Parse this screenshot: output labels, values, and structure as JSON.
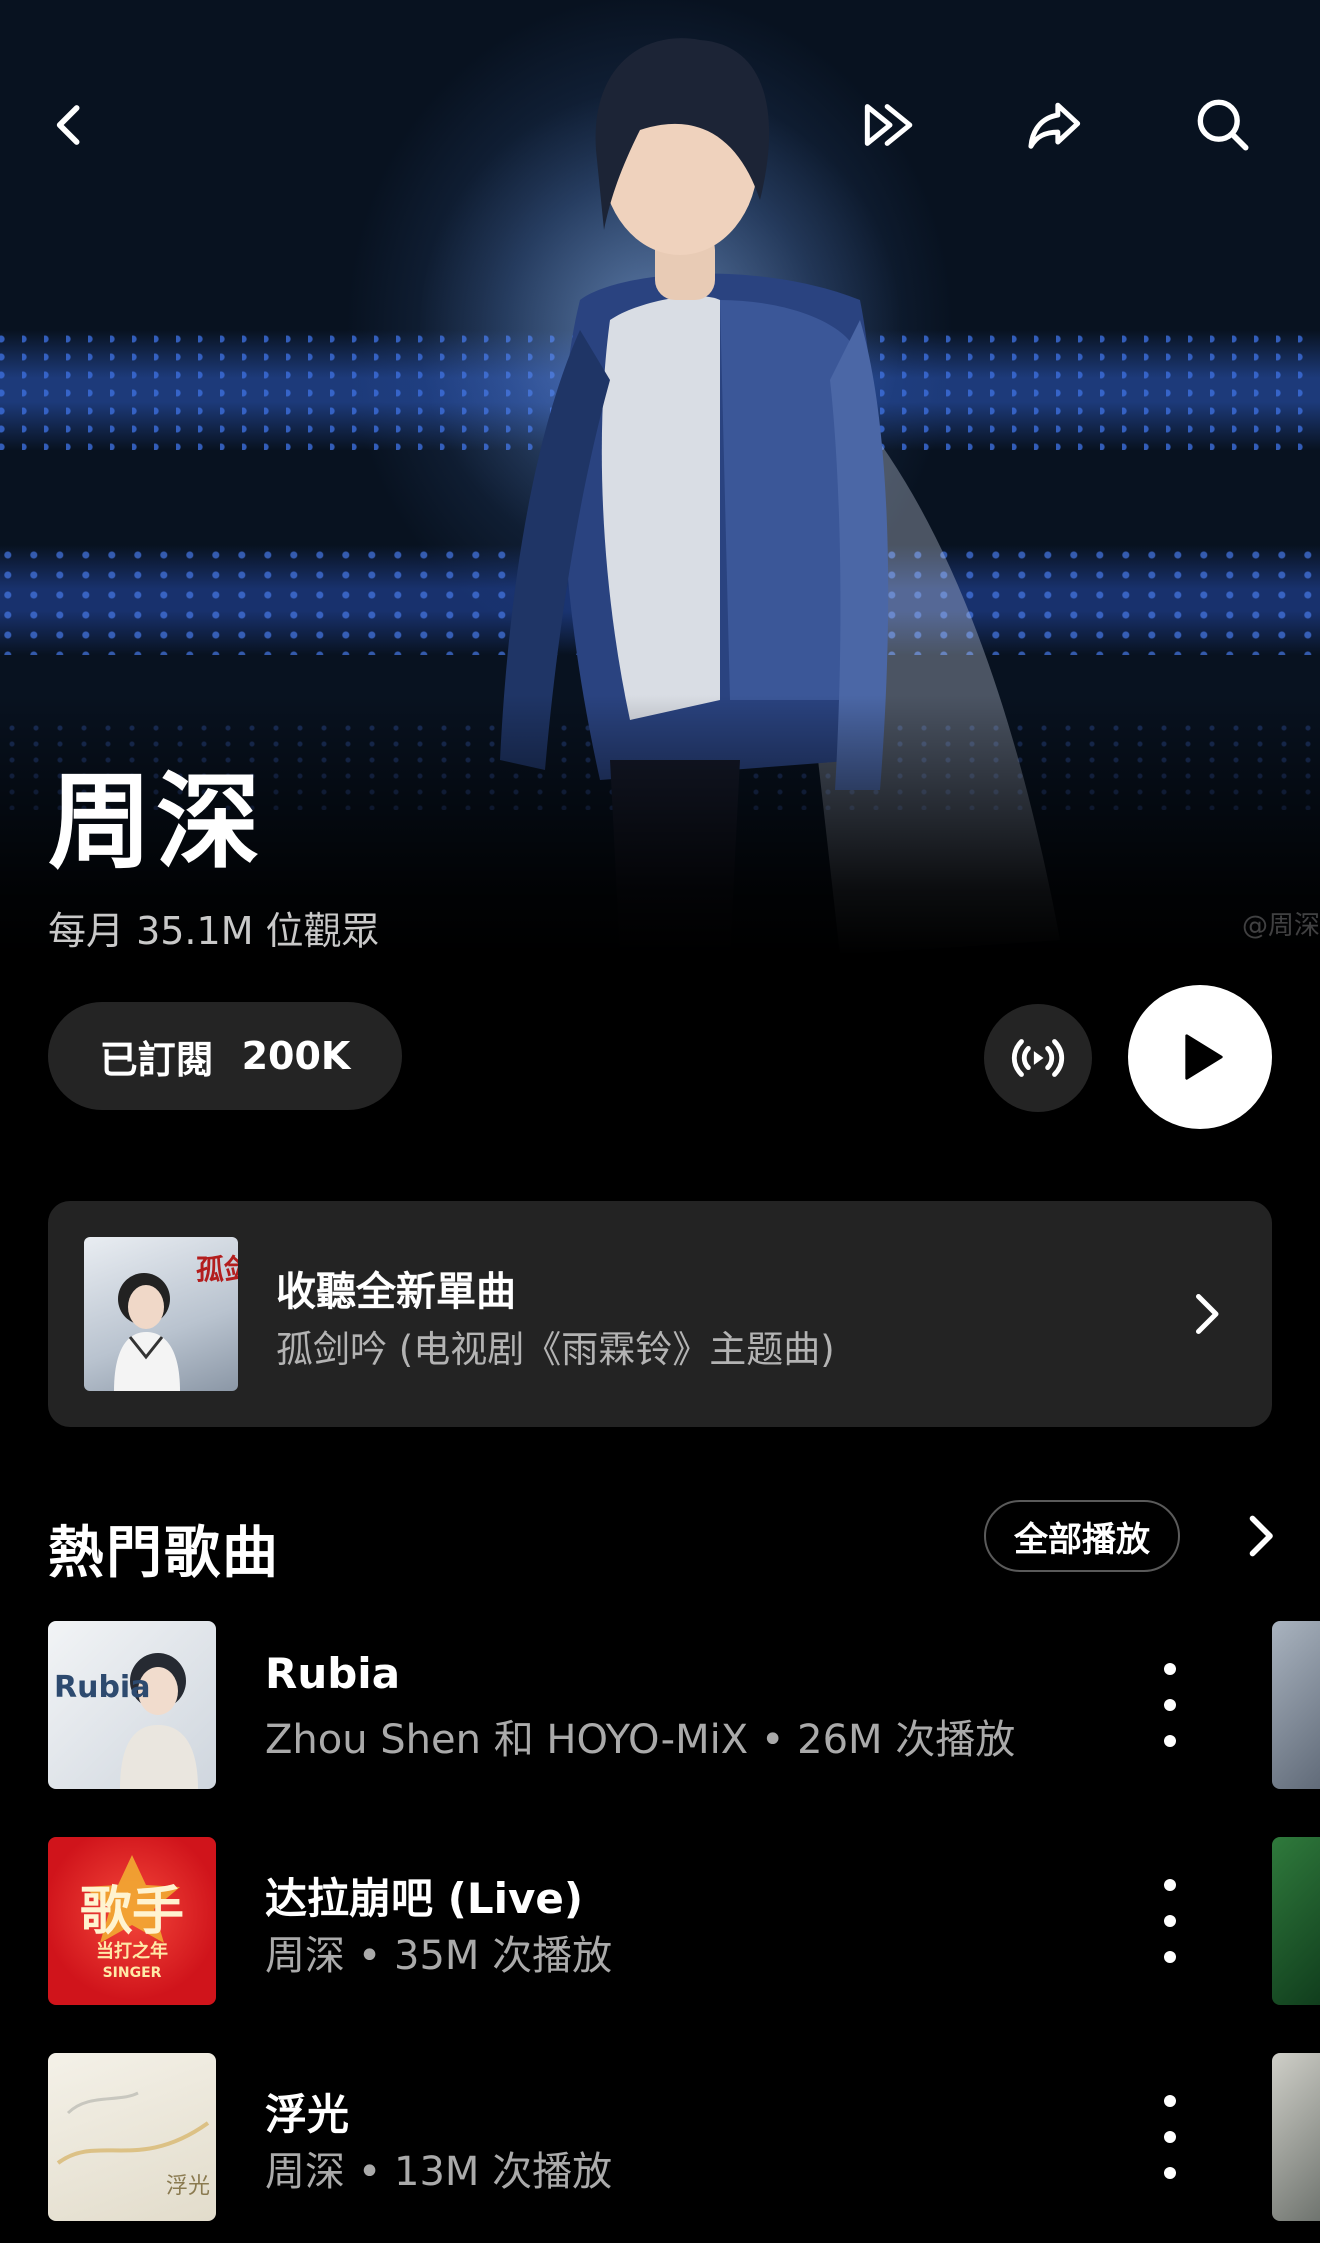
{
  "artist": {
    "name": "周深",
    "monthly_listeners": "每月 35.1M 位觀眾",
    "watermark": "@周深"
  },
  "actions": {
    "subscribe_label": "已訂閱",
    "subscriber_count": "200K"
  },
  "promo": {
    "title": "收聽全新單曲",
    "subtitle": "孤剑吟 (电视剧《雨霖铃》主题曲)",
    "art_text": "孤剑吟"
  },
  "top_songs": {
    "title": "熱門歌曲",
    "play_all": "全部播放",
    "items": [
      {
        "title": "Rubia",
        "meta": "Zhou Shen 和 HOYO-MiX • 26M 次播放",
        "art_text": "Rubia"
      },
      {
        "title": "达拉崩吧 (Live)",
        "meta": "周深 • 35M 次播放",
        "art_text": "歌手",
        "art_sub": "当打之年",
        "art_sub2": "SINGER"
      },
      {
        "title": "浮光",
        "meta": "周深 • 13M 次播放",
        "art_text": "浮光"
      }
    ]
  },
  "icons": [
    "back-icon",
    "fast-forward-icon",
    "share-icon",
    "search-icon",
    "radio-icon",
    "play-icon",
    "chevron-right-icon",
    "more-vert-icon"
  ],
  "colors": {
    "background": "#000000",
    "surface": "#232323",
    "text_secondary": "#aaaaaa",
    "accent": "#ffffff"
  }
}
